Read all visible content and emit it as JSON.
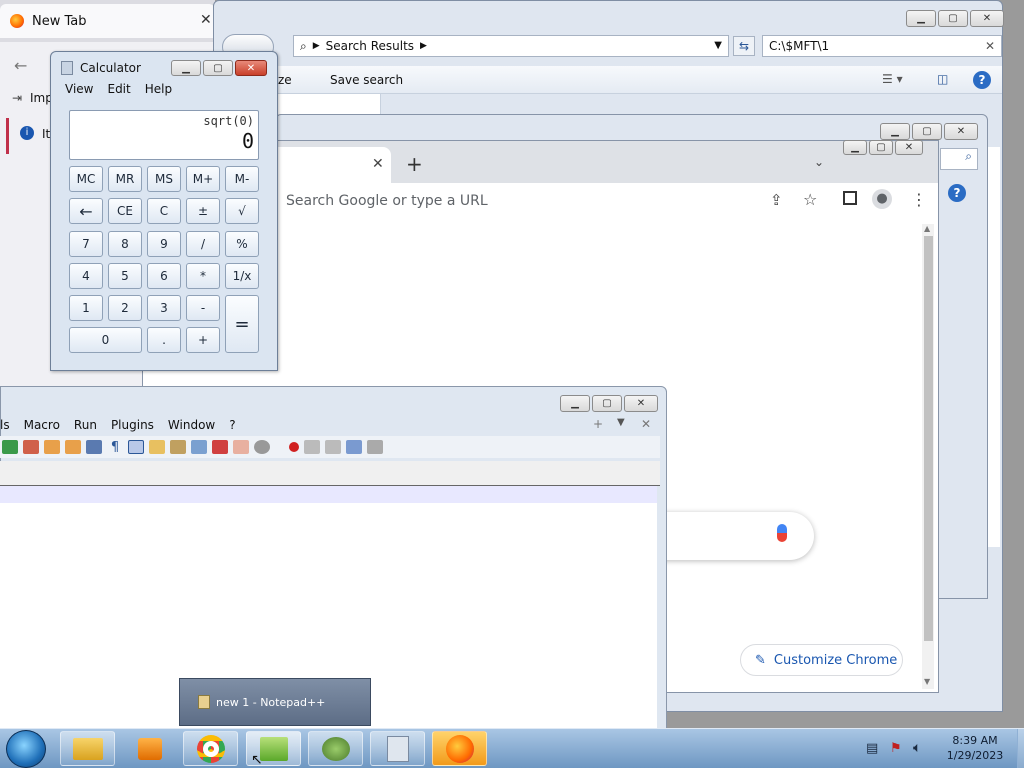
{
  "firefox": {
    "tab_title": "New Tab",
    "side_texts": [
      "Imp",
      "It"
    ]
  },
  "explorer": {
    "address": "Search Results",
    "search_value": "C:\\$MFT\\1",
    "toolbar": {
      "partial_label": "ze",
      "save_search": "Save search"
    }
  },
  "chrome": {
    "omnibox_placeholder": "Search Google or type a URL",
    "customize_label": "Customize Chrome",
    "accent": "#1a73e8"
  },
  "notepad": {
    "menu": [
      "ls",
      "Macro",
      "Run",
      "Plugins",
      "Window",
      "?"
    ],
    "preview_title": "new 1 - Notepad++"
  },
  "calculator": {
    "title": "Calculator",
    "menu": [
      "View",
      "Edit",
      "Help"
    ],
    "expression": "sqrt(0)",
    "result": "0",
    "keys": [
      [
        "MC",
        "MR",
        "MS",
        "M+",
        "M-"
      ],
      [
        "←",
        "CE",
        "C",
        "±",
        "√"
      ],
      [
        "7",
        "8",
        "9",
        "/",
        "%"
      ],
      [
        "4",
        "5",
        "6",
        "*",
        "1/x"
      ],
      [
        "1",
        "2",
        "3",
        "-",
        "="
      ],
      [
        "0",
        ".",
        "+"
      ]
    ]
  },
  "taskbar": {
    "time": "8:39 AM",
    "date": "1/29/2023"
  }
}
